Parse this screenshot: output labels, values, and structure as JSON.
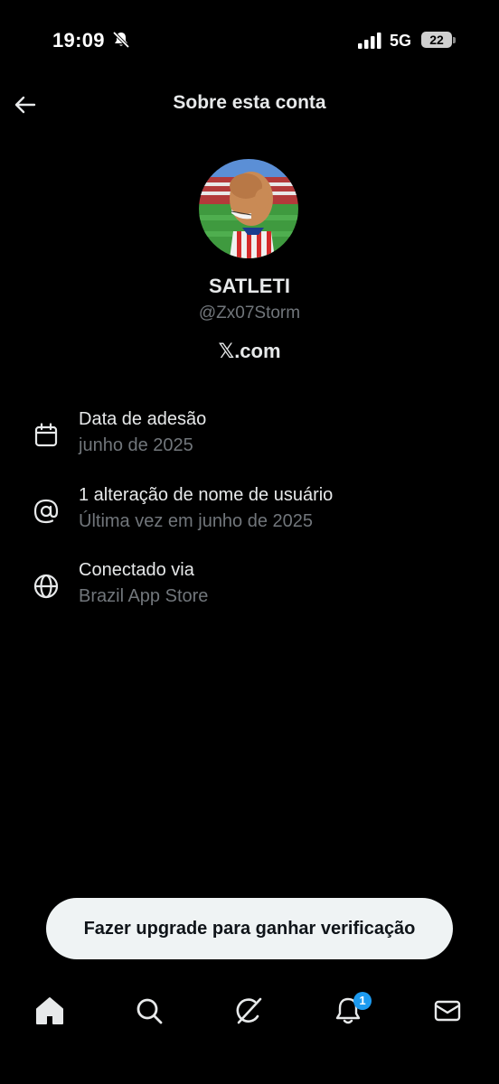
{
  "status_bar": {
    "time": "19:09",
    "network": "5G",
    "battery": "22",
    "icons": [
      "bell-off-icon",
      "signal-icon",
      "battery-icon"
    ]
  },
  "header": {
    "title": "Sobre esta conta",
    "back_icon": "arrow-left-icon"
  },
  "profile": {
    "display_name": "SATLETI",
    "handle": "@Zx07Storm",
    "source_logo": "𝕏",
    "source_text": ".com"
  },
  "info": [
    {
      "icon": "calendar-icon",
      "title": "Data de adesão",
      "subtitle": "junho de 2025"
    },
    {
      "icon": "at-icon",
      "title": "1 alteração de nome de usuário",
      "subtitle": "Última vez em junho de 2025"
    },
    {
      "icon": "globe-icon",
      "title": "Conectado via",
      "subtitle": "Brazil App Store"
    }
  ],
  "upgrade_button": "Fazer upgrade para ganhar verificação",
  "bottom_nav": {
    "items": [
      "home-icon",
      "search-icon",
      "grok-icon",
      "notifications-icon",
      "messages-icon"
    ],
    "notifications_badge": "1"
  },
  "colors": {
    "background": "#000000",
    "primary_text": "#e7e9ea",
    "secondary_text": "#71767b",
    "badge": "#1d9bf0",
    "button_bg": "#eff3f4"
  }
}
